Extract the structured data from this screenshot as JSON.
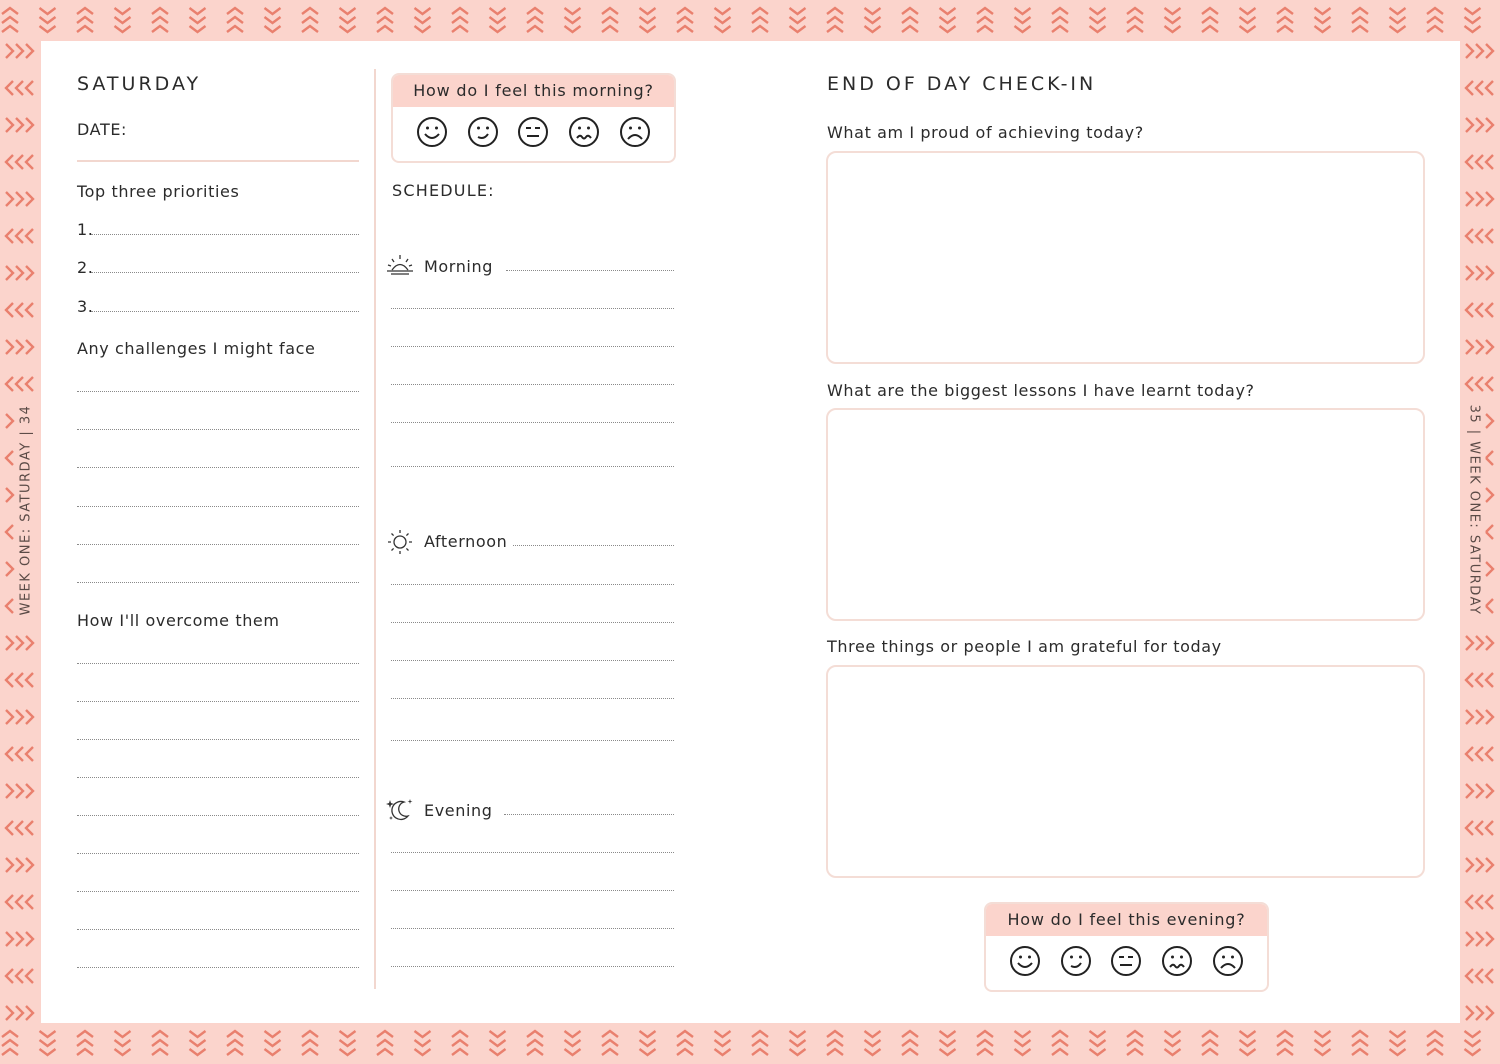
{
  "left_page": {
    "side_label": "WEEK ONE: SATURDAY | 34",
    "day_title": "SATURDAY",
    "date_label": "DATE:",
    "priorities_label": "Top three priorities",
    "priority_numbers": [
      "1.",
      "2.",
      "3."
    ],
    "challenges_label": "Any challenges I might face",
    "overcome_label": "How I'll overcome them",
    "morning_mood": {
      "question": "How do I feel this morning?",
      "faces": [
        "very-happy-face-icon",
        "happy-face-icon",
        "neutral-face-icon",
        "worried-face-icon",
        "sad-face-icon"
      ]
    },
    "schedule_label": "SCHEDULE:",
    "schedule_slots": [
      {
        "label": "Morning",
        "icon": "sunrise-icon"
      },
      {
        "label": "Afternoon",
        "icon": "sun-icon"
      },
      {
        "label": "Evening",
        "icon": "moon-stars-icon"
      }
    ]
  },
  "right_page": {
    "side_label": "35 | WEEK ONE: SATURDAY",
    "title": "END OF DAY CHECK-IN",
    "questions": [
      "What am I proud of achieving today?",
      "What are the biggest lessons I have learnt today?",
      "Three things or people I am grateful for today"
    ],
    "evening_mood": {
      "question": "How do I feel this evening?",
      "faces": [
        "very-happy-face-icon",
        "happy-face-icon",
        "neutral-face-icon",
        "worried-face-icon",
        "sad-face-icon"
      ]
    }
  },
  "colors": {
    "border_pink": "#fbd4cc",
    "chevron": "#e9806e",
    "box_outline": "#f4ddd6"
  }
}
